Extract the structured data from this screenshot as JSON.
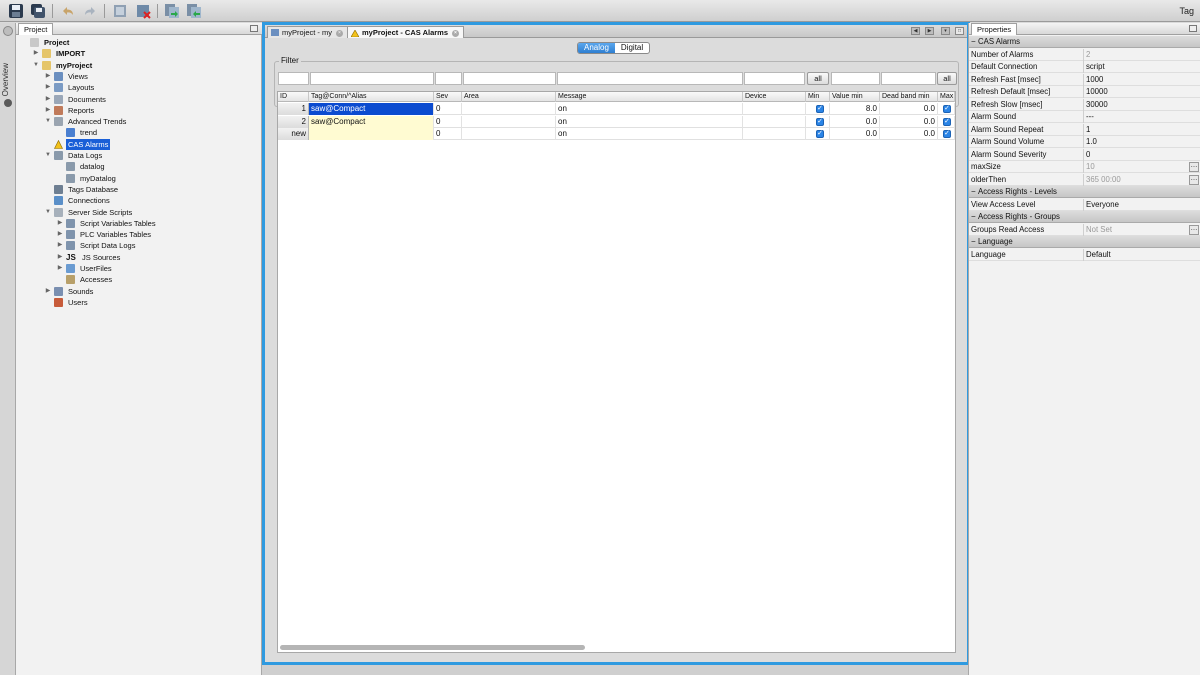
{
  "toolbar": {
    "tag_label": "Tag",
    "icons": [
      "save-icon",
      "save-all-icon",
      "undo-icon",
      "redo-icon",
      "deploy-icon",
      "clean-icon",
      "import-icon",
      "export-icon"
    ]
  },
  "overview": {
    "label": "Overview"
  },
  "project_panel": {
    "tab": "Project",
    "tree": [
      {
        "label": "Project",
        "depth": 0,
        "bold": true,
        "expander": "",
        "icon": "project-icon"
      },
      {
        "label": "IMPORT",
        "depth": 1,
        "bold": true,
        "expander": "▶",
        "icon": "folder-icon"
      },
      {
        "label": "myProject",
        "depth": 1,
        "bold": true,
        "expander": "▼",
        "icon": "folder-icon"
      },
      {
        "label": "Views",
        "depth": 2,
        "bold": false,
        "expander": "▶",
        "icon": "views-icon"
      },
      {
        "label": "Layouts",
        "depth": 2,
        "bold": false,
        "expander": "▶",
        "icon": "layouts-icon"
      },
      {
        "label": "Documents",
        "depth": 2,
        "bold": false,
        "expander": "▶",
        "icon": "documents-icon"
      },
      {
        "label": "Reports",
        "depth": 2,
        "bold": false,
        "expander": "▶",
        "icon": "reports-icon"
      },
      {
        "label": "Advanced Trends",
        "depth": 2,
        "bold": false,
        "expander": "▼",
        "icon": "trends-icon"
      },
      {
        "label": "trend",
        "depth": 3,
        "bold": false,
        "expander": "",
        "icon": "trend-line-icon"
      },
      {
        "label": "CAS Alarms",
        "depth": 2,
        "bold": false,
        "expander": "",
        "icon": "warning-icon",
        "selected": true
      },
      {
        "label": "Data Logs",
        "depth": 2,
        "bold": false,
        "expander": "▼",
        "icon": "datalog-icon"
      },
      {
        "label": "datalog",
        "depth": 3,
        "bold": false,
        "expander": "",
        "icon": "datalog-icon"
      },
      {
        "label": "myDatalog",
        "depth": 3,
        "bold": false,
        "expander": "",
        "icon": "datalog-icon"
      },
      {
        "label": "Tags Database",
        "depth": 2,
        "bold": false,
        "expander": "",
        "icon": "database-icon"
      },
      {
        "label": "Connections",
        "depth": 2,
        "bold": false,
        "expander": "",
        "icon": "connection-icon"
      },
      {
        "label": "Server Side Scripts",
        "depth": 2,
        "bold": false,
        "expander": "▼",
        "icon": "script-icon"
      },
      {
        "label": "Script Variables Tables",
        "depth": 3,
        "bold": false,
        "expander": "▶",
        "icon": "table-icon"
      },
      {
        "label": "PLC Variables Tables",
        "depth": 3,
        "bold": false,
        "expander": "▶",
        "icon": "table-icon"
      },
      {
        "label": "Script Data Logs",
        "depth": 3,
        "bold": false,
        "expander": "▶",
        "icon": "table-icon"
      },
      {
        "label": "JS Sources",
        "depth": 3,
        "bold": false,
        "expander": "▶",
        "icon": "js-icon",
        "icon_text": "JS"
      },
      {
        "label": "UserFiles",
        "depth": 3,
        "bold": false,
        "expander": "▶",
        "icon": "files-icon"
      },
      {
        "label": "Accesses",
        "depth": 3,
        "bold": false,
        "expander": "",
        "icon": "key-icon"
      },
      {
        "label": "Sounds",
        "depth": 2,
        "bold": false,
        "expander": "▶",
        "icon": "sound-icon"
      },
      {
        "label": "Users",
        "depth": 2,
        "bold": false,
        "expander": "",
        "icon": "users-icon"
      }
    ]
  },
  "editor": {
    "tabs": [
      {
        "label": "myProject - my",
        "active": false
      },
      {
        "label": "myProject - CAS Alarms",
        "active": true
      }
    ],
    "segment": {
      "analog": "Analog",
      "digital": "Digital"
    },
    "filter": {
      "title": "Filter",
      "all_button": "all"
    },
    "columns": [
      "ID",
      "Tag@Conn/^Alias",
      "Sev",
      "Area",
      "Message",
      "Device",
      "Min",
      "Value min",
      "Dead band min",
      "Max"
    ],
    "rows": [
      {
        "id": "1",
        "tag": "saw@Compact",
        "sev": "0",
        "area": "",
        "message": "on",
        "device": "",
        "min": true,
        "value_min": "8.0",
        "dead_band_min": "0.0",
        "max": true,
        "selected": true
      },
      {
        "id": "2",
        "tag": "saw@Compact",
        "sev": "0",
        "area": "",
        "message": "on",
        "device": "",
        "min": true,
        "value_min": "0.0",
        "dead_band_min": "0.0",
        "max": true,
        "selected": false
      },
      {
        "id": "new",
        "tag": "",
        "sev": "0",
        "area": "",
        "message": "on",
        "device": "",
        "min": true,
        "value_min": "0.0",
        "dead_band_min": "0.0",
        "max": true,
        "selected": false
      }
    ]
  },
  "properties": {
    "tab": "Properties",
    "rows": [
      {
        "type": "cat",
        "label": "CAS Alarms"
      },
      {
        "type": "prop",
        "key": "Number of Alarms",
        "value": "2",
        "grey": true
      },
      {
        "type": "prop",
        "key": "Default Connection",
        "value": "script"
      },
      {
        "type": "prop",
        "key": "Refresh Fast [msec]",
        "value": "1000"
      },
      {
        "type": "prop",
        "key": "Refresh Default [msec]",
        "value": "10000"
      },
      {
        "type": "prop",
        "key": "Refresh Slow [msec]",
        "value": "30000"
      },
      {
        "type": "prop",
        "key": "Alarm Sound",
        "value": "---"
      },
      {
        "type": "prop",
        "key": "Alarm Sound Repeat",
        "value": "1"
      },
      {
        "type": "prop",
        "key": "Alarm Sound Volume",
        "value": "1.0"
      },
      {
        "type": "prop",
        "key": "Alarm Sound Severity",
        "value": "0"
      },
      {
        "type": "prop",
        "key": "maxSize",
        "value": "10",
        "grey": true,
        "more": true
      },
      {
        "type": "prop",
        "key": "olderThen",
        "value": "365 00:00",
        "grey": true,
        "more": true
      },
      {
        "type": "cat",
        "label": "Access Rights - Levels"
      },
      {
        "type": "prop",
        "key": "View Access Level",
        "value": "Everyone"
      },
      {
        "type": "cat",
        "label": "Access Rights - Groups"
      },
      {
        "type": "prop",
        "key": "Groups Read Access",
        "value": "Not Set",
        "grey": true,
        "more": true
      },
      {
        "type": "cat",
        "label": "Language"
      },
      {
        "type": "prop",
        "key": "Language",
        "value": "Default"
      }
    ]
  },
  "colors": {
    "accent": "#2f9ae0",
    "selection": "#1a5fd7",
    "checkbox": "#2a84e6",
    "new_row": "#fffbd2"
  }
}
